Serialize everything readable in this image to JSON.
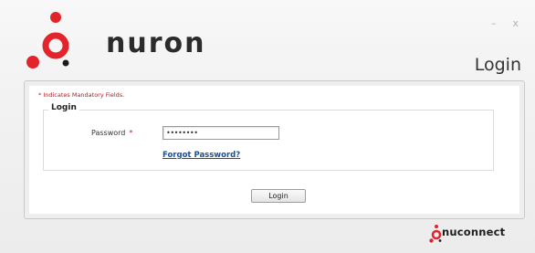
{
  "header": {
    "brand": "nuron",
    "page_title": "Login",
    "minimize_glyph": "–",
    "close_glyph": "x"
  },
  "form": {
    "mandatory_note": "* Indicates Mandatory Fields.",
    "section_title": "Login",
    "password_label": "Password",
    "required_marker": "*",
    "password_value": "••••••••",
    "forgot_link": "Forgot Password?",
    "submit_label": "Login"
  },
  "footer": {
    "brand": "nuconnect"
  },
  "colors": {
    "brand_red": "#e2242b",
    "brand_dark": "#2b2b2b",
    "link_blue": "#1f4f93",
    "required_red": "#c02020"
  },
  "icons": {
    "logo": "nuron-logo-icon",
    "footer_logo": "nuconnect-logo-icon"
  }
}
